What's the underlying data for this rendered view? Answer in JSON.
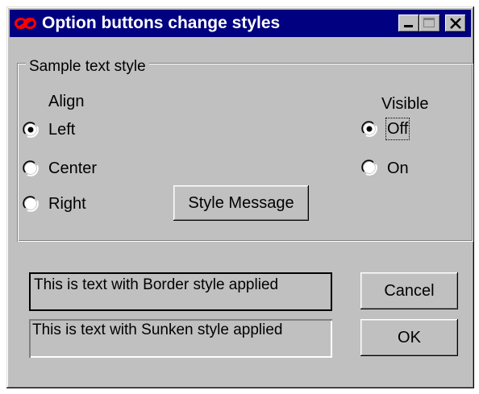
{
  "window": {
    "title": "Option buttons change styles"
  },
  "titlebar_buttons": {
    "minimize_icon": "minimize-icon",
    "maximize_icon": "maximize-icon",
    "close_icon": "close-icon"
  },
  "group": {
    "legend": "Sample text style",
    "align": {
      "label": "Align",
      "options": [
        {
          "label": "Left",
          "selected": true
        },
        {
          "label": "Center",
          "selected": false
        },
        {
          "label": "Right",
          "selected": false
        }
      ]
    },
    "visible": {
      "label": "Visible",
      "options": [
        {
          "label": "Off",
          "selected": true,
          "focused": true
        },
        {
          "label": "On",
          "selected": false
        }
      ]
    },
    "style_message_button": "Style Message"
  },
  "samples": {
    "border_text": "This is text with Border style applied",
    "sunken_text": "This is text with Sunken style applied"
  },
  "buttons": {
    "cancel": "Cancel",
    "ok": "OK"
  },
  "colors": {
    "titlebar_bg": "#000080",
    "window_bg": "#c0c0c0",
    "titlebar_text": "#ffffff",
    "icon_accent": "#ff0000"
  }
}
